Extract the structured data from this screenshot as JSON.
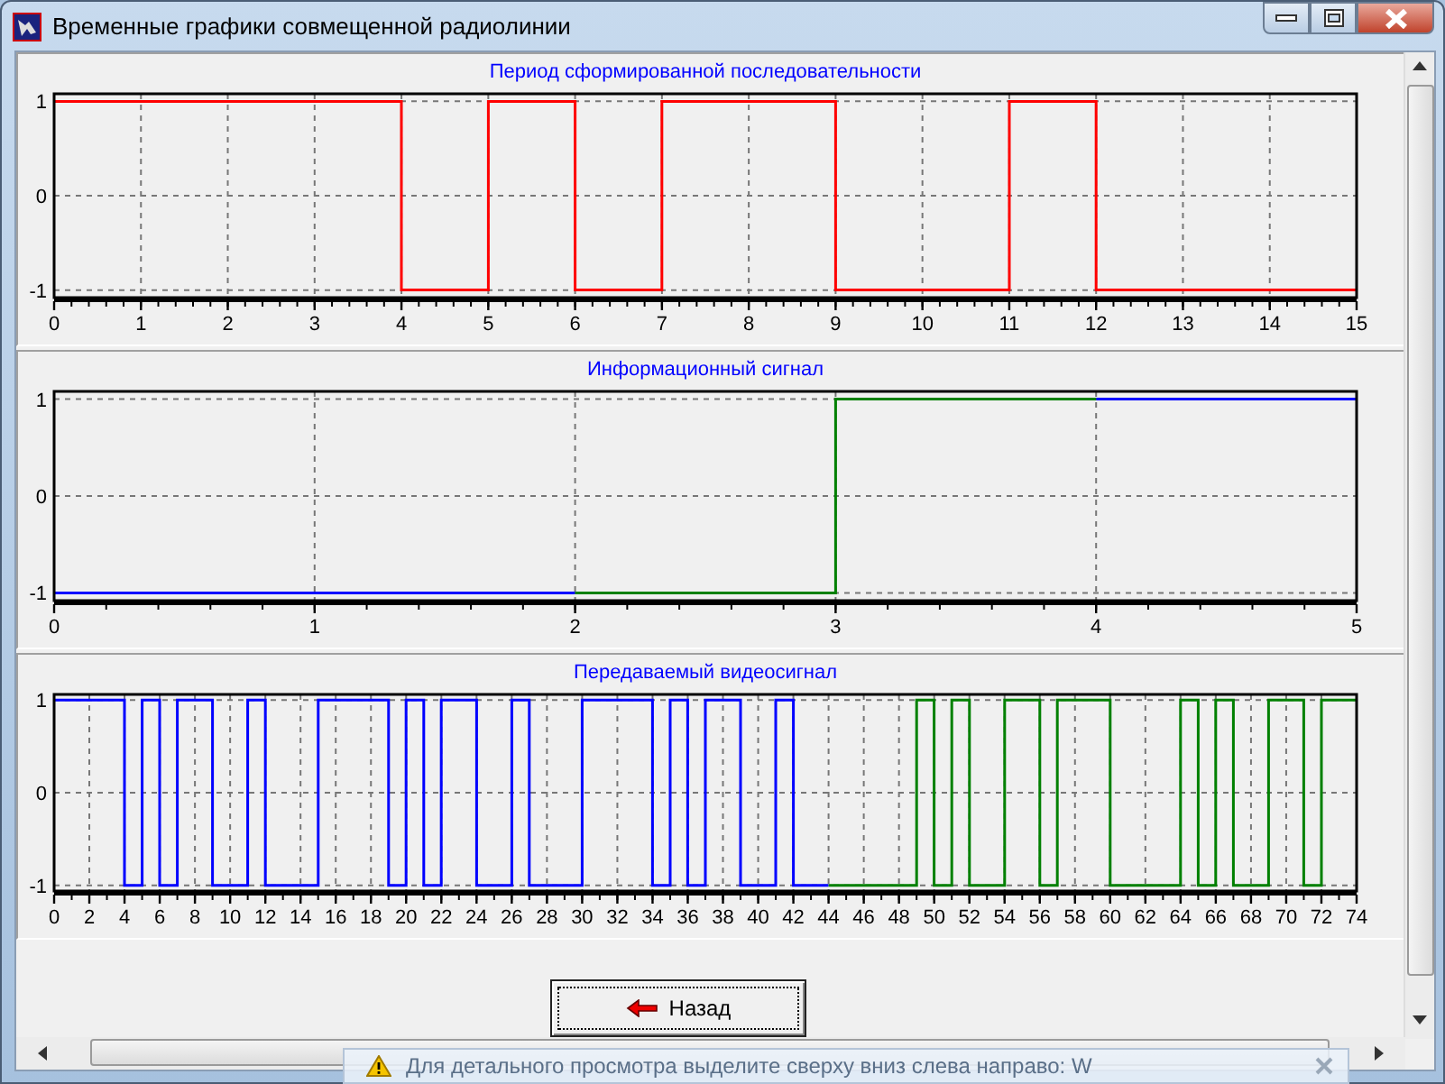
{
  "window": {
    "title": "Временные графики совмещенной радиолинии"
  },
  "panels": [
    {
      "chart_data": {
        "type": "line",
        "title": "Период сформированной последовательности",
        "x": [
          0,
          4,
          4,
          5,
          5,
          6,
          6,
          7,
          7,
          9,
          9,
          11,
          11,
          12,
          12,
          15
        ],
        "series": [
          {
            "color": "#ff0000",
            "values": [
              1,
              1,
              -1,
              -1,
              1,
              1,
              -1,
              -1,
              1,
              1,
              -1,
              -1,
              1,
              1,
              -1,
              -1
            ]
          }
        ],
        "grid": true,
        "xlim": [
          0,
          15
        ],
        "ylim": [
          -1.08,
          1.08
        ],
        "xticks": [
          0,
          1,
          2,
          3,
          4,
          5,
          6,
          7,
          8,
          9,
          10,
          11,
          12,
          13,
          14,
          15
        ],
        "yticks": [
          -1,
          0,
          1
        ]
      }
    },
    {
      "chart_data": {
        "type": "line",
        "title": "Информационный сигнал",
        "x": [
          0,
          2,
          2,
          3,
          3,
          4,
          4,
          5
        ],
        "series": [
          {
            "color": "#0000ff",
            "values": [
              -1,
              -1,
              null,
              null,
              null,
              null,
              1,
              1
            ]
          },
          {
            "color": "#008000",
            "values": [
              null,
              null,
              -1,
              -1,
              1,
              1,
              null,
              null
            ]
          }
        ],
        "grid": true,
        "xlim": [
          0,
          5
        ],
        "ylim": [
          -1.08,
          1.08
        ],
        "xticks": [
          0,
          1,
          2,
          3,
          4,
          5
        ],
        "yticks": [
          -1,
          0,
          1
        ]
      }
    },
    {
      "chart_data": {
        "type": "line",
        "title": "Передаваемый видеосигнал",
        "x": [
          0,
          4,
          4,
          5,
          5,
          6,
          6,
          7,
          7,
          9,
          9,
          11,
          11,
          12,
          12,
          15,
          15,
          19,
          19,
          20,
          20,
          21,
          21,
          22,
          22,
          24,
          24,
          26,
          26,
          27,
          27,
          30,
          30,
          34,
          34,
          35,
          35,
          36,
          36,
          37,
          37,
          39,
          39,
          41,
          41,
          42,
          42,
          44,
          44,
          49,
          49,
          50,
          50,
          51,
          51,
          52,
          52,
          54,
          54,
          56,
          56,
          57,
          57,
          60,
          60,
          64,
          64,
          65,
          65,
          66,
          66,
          67,
          67,
          69,
          69,
          71,
          71,
          72,
          72,
          74
        ],
        "series": [
          {
            "color": "#0000ff",
            "values": [
              1,
              1,
              -1,
              -1,
              1,
              1,
              -1,
              -1,
              1,
              1,
              -1,
              -1,
              1,
              1,
              -1,
              -1,
              1,
              1,
              -1,
              -1,
              1,
              1,
              -1,
              -1,
              1,
              1,
              -1,
              -1,
              1,
              1,
              -1,
              -1,
              1,
              1,
              -1,
              -1,
              1,
              1,
              -1,
              -1,
              1,
              1,
              -1,
              -1,
              1,
              1,
              -1,
              -1,
              null,
              null,
              null,
              null,
              null,
              null,
              null,
              null,
              null,
              null,
              null,
              null,
              null,
              null,
              null,
              null,
              null,
              null,
              null,
              null,
              null,
              null,
              null,
              null,
              null,
              null,
              null,
              null,
              null,
              null,
              null,
              null
            ]
          },
          {
            "color": "#008000",
            "values": [
              null,
              null,
              null,
              null,
              null,
              null,
              null,
              null,
              null,
              null,
              null,
              null,
              null,
              null,
              null,
              null,
              null,
              null,
              null,
              null,
              null,
              null,
              null,
              null,
              null,
              null,
              null,
              null,
              null,
              null,
              null,
              null,
              null,
              null,
              null,
              null,
              null,
              null,
              null,
              null,
              null,
              null,
              null,
              null,
              null,
              null,
              null,
              null,
              -1,
              -1,
              1,
              1,
              -1,
              -1,
              1,
              1,
              -1,
              -1,
              1,
              1,
              -1,
              -1,
              1,
              1,
              -1,
              -1,
              1,
              1,
              -1,
              -1,
              1,
              1,
              -1,
              -1,
              1,
              1,
              -1,
              -1,
              1,
              1
            ]
          }
        ],
        "grid": true,
        "xlim": [
          0,
          74
        ],
        "ylim": [
          -1.06,
          1.06
        ],
        "xticks": [
          0,
          2,
          4,
          6,
          8,
          10,
          12,
          14,
          16,
          18,
          20,
          22,
          24,
          26,
          28,
          30,
          32,
          34,
          36,
          38,
          40,
          42,
          44,
          46,
          48,
          50,
          52,
          54,
          56,
          58,
          60,
          62,
          64,
          66,
          68,
          70,
          72,
          74
        ],
        "yticks": [
          -1,
          0,
          1
        ]
      }
    }
  ],
  "back_button": {
    "label": "Назад"
  },
  "notification": {
    "text": "Для детального просмотра выделите сверху вниз слева направо: W"
  }
}
